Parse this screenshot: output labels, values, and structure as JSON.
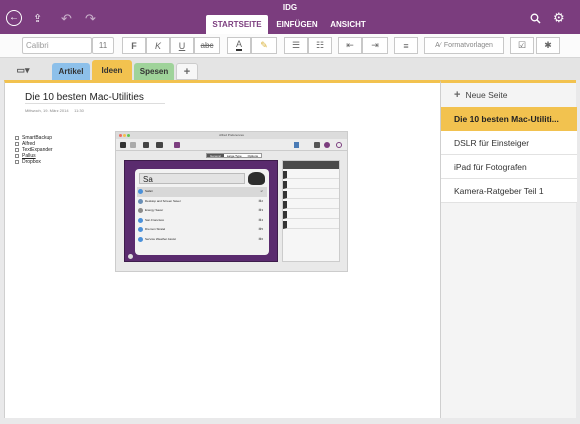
{
  "header": {
    "app_title": "IDG",
    "tabs": [
      "STARTSEITE",
      "EINFÜGEN",
      "ANSICHT"
    ],
    "icons": [
      "back-icon",
      "share-icon",
      "undo-icon",
      "redo-icon",
      "search-icon",
      "gear-icon"
    ]
  },
  "toolbar": {
    "font_name": "Calibri",
    "font_size": "11",
    "bold": "F",
    "italic": "K",
    "underline": "U",
    "strike": "abc",
    "styles_label": "Formatvorlagen"
  },
  "sections": {
    "tabs": [
      "Artikel",
      "Ideen",
      "Spesen"
    ],
    "add": "+"
  },
  "note": {
    "title": "Die 10 besten Mac-Utilities",
    "date": "Mittwoch, 19. März 2014",
    "time": "11:30",
    "list": [
      "SmartBackup",
      "Alfred",
      "TextExpander",
      "Pallus",
      "Dropbox"
    ]
  },
  "embedded": {
    "window_title": "Alfred Preferences",
    "tabs": [
      "General",
      "Large Type",
      "Options"
    ],
    "search_text": "Sa",
    "results": [
      "Safari",
      "Desktop and Screen Saver",
      "Energy Saver",
      "San Francisco",
      "Dremon Stratel",
      "Service Weather Assist"
    ],
    "shortcuts": [
      "↵",
      "⌘2",
      "⌘3",
      "⌘4",
      "⌘5",
      "⌘6"
    ]
  },
  "pages": {
    "new_page_label": "Neue Seite",
    "items": [
      "Die 10 besten Mac-Utiliti...",
      "DSLR für Einsteiger",
      "iPad für Fotografen",
      "Kamera-Ratgeber Teil 1"
    ]
  },
  "colors": {
    "accent": "#7b3d7e",
    "section_yellow": "#f2c24f",
    "artikel_blue": "#8dc0ea",
    "spesen_green": "#9fd39a"
  }
}
